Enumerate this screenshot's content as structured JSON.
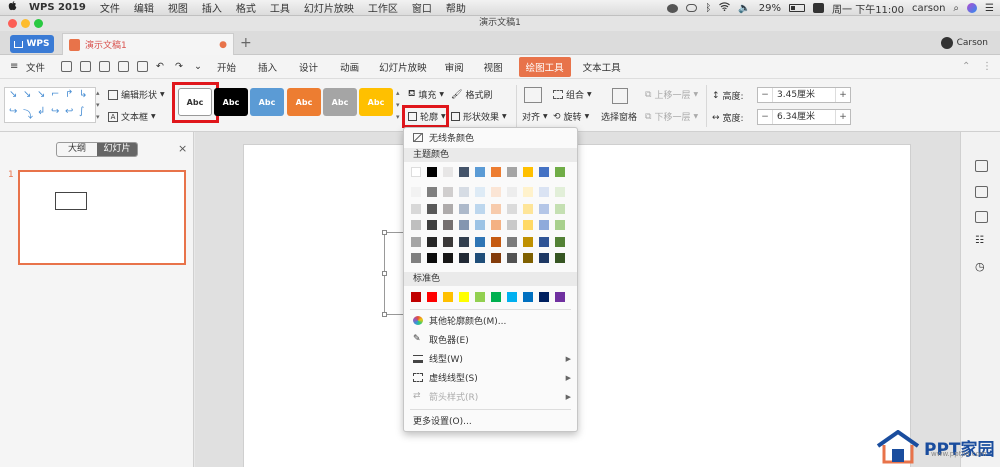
{
  "menubar": {
    "app_name": "WPS 2019",
    "items": [
      "文件",
      "编辑",
      "视图",
      "插入",
      "格式",
      "工具",
      "幻灯片放映",
      "工作区",
      "窗口",
      "帮助"
    ],
    "battery": "29%",
    "clock": "周一 下午11:00",
    "user": "carson"
  },
  "window": {
    "title": "演示文稿1"
  },
  "tabs": {
    "wps_label": "WPS",
    "doc_label": "演示文稿1",
    "add": "+",
    "user": "Carson"
  },
  "menu": {
    "file": "文件",
    "items": [
      "开始",
      "插入",
      "设计",
      "动画",
      "幻灯片放映",
      "审阅",
      "视图",
      "绘图工具",
      "文本工具"
    ],
    "active": "绘图工具"
  },
  "ribbon": {
    "edit_shape": "编辑形状",
    "text_box": "文本框",
    "style_sample": "Abc",
    "styles": [
      {
        "bg": "#ffffff",
        "fg": "#333333"
      },
      {
        "bg": "#000000",
        "fg": "#ffffff"
      },
      {
        "bg": "#5b9bd5",
        "fg": "#ffffff"
      },
      {
        "bg": "#ed7d31",
        "fg": "#ffffff"
      },
      {
        "bg": "#a5a5a5",
        "fg": "#ffffff"
      },
      {
        "bg": "#ffc000",
        "fg": "#ffffff"
      }
    ],
    "fill": "填充",
    "format_painter": "格式刷",
    "outline": "轮廓",
    "shape_effects": "形状效果",
    "align": "对齐",
    "group": "组合",
    "rotate": "旋转",
    "selection_pane": "选择窗格",
    "bring_forward": "上移一层",
    "send_backward": "下移一层",
    "height_label": "高度:",
    "height_value": "3.45厘米",
    "width_label": "宽度:",
    "width_value": "6.34厘米"
  },
  "left_panel": {
    "tab_outline": "大纲",
    "tab_slides": "幻灯片",
    "close": "×",
    "slide_number": "1"
  },
  "dropdown": {
    "no_outline": "无线条颜色",
    "theme_colors": "主题颜色",
    "theme_top": [
      "#ffffff",
      "#000000",
      "#e7e6e6",
      "#44546a",
      "#5b9bd5",
      "#ed7d31",
      "#a5a5a5",
      "#ffc000",
      "#4472c4",
      "#70ad47"
    ],
    "theme_rows": [
      [
        "#f2f2f2",
        "#7f7f7f",
        "#d0cece",
        "#d6dce4",
        "#deebf6",
        "#fbe5d5",
        "#ededed",
        "#fff2cc",
        "#dae3f3",
        "#e2efd9"
      ],
      [
        "#d8d8d8",
        "#595959",
        "#aeabab",
        "#adb9ca",
        "#bdd7ee",
        "#f7cbac",
        "#dbdbdb",
        "#fee599",
        "#b4c6e7",
        "#c5e0b3"
      ],
      [
        "#bfbfbf",
        "#3f3f3f",
        "#757070",
        "#8496b0",
        "#9cc3e5",
        "#f4b183",
        "#c9c9c9",
        "#ffd965",
        "#8eaadb",
        "#a8d08d"
      ],
      [
        "#a5a5a5",
        "#262626",
        "#3a3838",
        "#323f4f",
        "#2e75b5",
        "#c55a11",
        "#7b7b7b",
        "#bf9000",
        "#2f5496",
        "#538135"
      ],
      [
        "#7f7f7f",
        "#0c0c0c",
        "#171616",
        "#222a35",
        "#1f4e79",
        "#843c0b",
        "#525252",
        "#7f6000",
        "#1e3864",
        "#375623"
      ]
    ],
    "standard_colors_label": "标准色",
    "standard_colors": [
      "#c00000",
      "#ff0000",
      "#ffc000",
      "#ffff00",
      "#92d050",
      "#00b050",
      "#00b0f0",
      "#0070c0",
      "#002060",
      "#7030a0"
    ],
    "more_colors": "其他轮廓颜色(M)...",
    "eyedropper": "取色器(E)",
    "line_type": "线型(W)",
    "dash_type": "虚线线型(S)",
    "arrow_style": "箭头样式(R)",
    "more_settings": "更多设置(O)..."
  },
  "watermark": {
    "brand": "PPT家园",
    "url": "www.pptjia.com"
  }
}
